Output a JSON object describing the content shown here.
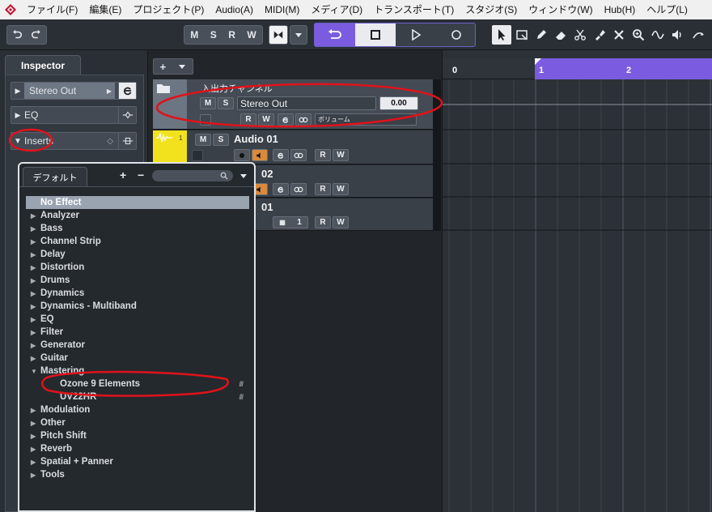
{
  "menu": {
    "items": [
      "ファイル(F)",
      "編集(E)",
      "プロジェクト(P)",
      "Audio(A)",
      "MIDI(M)",
      "メディア(D)",
      "トランスポート(T)",
      "スタジオ(S)",
      "ウィンドウ(W)",
      "Hub(H)",
      "ヘルプ(L)"
    ]
  },
  "toolbar": {
    "m_label": "M",
    "s_label": "S",
    "r_label": "R",
    "w_label": "W"
  },
  "inspector": {
    "tab_label": "Inspector",
    "rows": {
      "output": "Stereo Out",
      "eq": "EQ",
      "inserts": "Inserts"
    }
  },
  "tracklist": {
    "add_label": "+",
    "folder_track": {
      "name": "入出力チャンネル",
      "m": "M",
      "s": "S",
      "output": "Stereo Out",
      "volume_value": "0.00",
      "r": "R",
      "w": "W",
      "volume_label": "ボリューム"
    },
    "tracks": [
      {
        "number": "1",
        "name": "Audio 01",
        "m": "M",
        "s": "S",
        "r": "R",
        "w": "W"
      },
      {
        "name": "02",
        "r": "R",
        "w": "W"
      },
      {
        "name": "01",
        "channel": "1",
        "r": "R",
        "w": "W"
      }
    ]
  },
  "ruler": {
    "bars": [
      "0",
      "1",
      "2"
    ]
  },
  "popup": {
    "tab_label": "デフォルト",
    "plus_label": "+",
    "minus_label": "−",
    "items": [
      {
        "label": "No Effect",
        "selected": true,
        "expand": ""
      },
      {
        "label": "Analyzer",
        "expand": "▶"
      },
      {
        "label": "Bass",
        "expand": "▶"
      },
      {
        "label": "Channel Strip",
        "expand": "▶"
      },
      {
        "label": "Delay",
        "expand": "▶"
      },
      {
        "label": "Distortion",
        "expand": "▶"
      },
      {
        "label": "Drums",
        "expand": "▶"
      },
      {
        "label": "Dynamics",
        "expand": "▶"
      },
      {
        "label": "Dynamics - Multiband",
        "expand": "▶"
      },
      {
        "label": "EQ",
        "expand": "▶"
      },
      {
        "label": "Filter",
        "expand": "▶"
      },
      {
        "label": "Generator",
        "expand": "▶"
      },
      {
        "label": "Guitar",
        "expand": "▶"
      },
      {
        "label": "Mastering",
        "expand": "▼"
      },
      {
        "label": "Ozone 9 Elements",
        "child": true,
        "grip": "///"
      },
      {
        "label": "UV22HR",
        "child": true,
        "grip": "///"
      },
      {
        "label": "Modulation",
        "expand": "▶"
      },
      {
        "label": "Other",
        "expand": "▶"
      },
      {
        "label": "Pitch Shift",
        "expand": "▶"
      },
      {
        "label": "Reverb",
        "expand": "▶"
      },
      {
        "label": "Spatial + Panner",
        "expand": "▶"
      },
      {
        "label": "Tools",
        "expand": "▶"
      }
    ]
  },
  "colors": {
    "accent": "#7b5ce0",
    "track_yellow": "#f2e21d",
    "annotation_red": "#e0121a",
    "monitor_orange": "#d98a3c"
  }
}
